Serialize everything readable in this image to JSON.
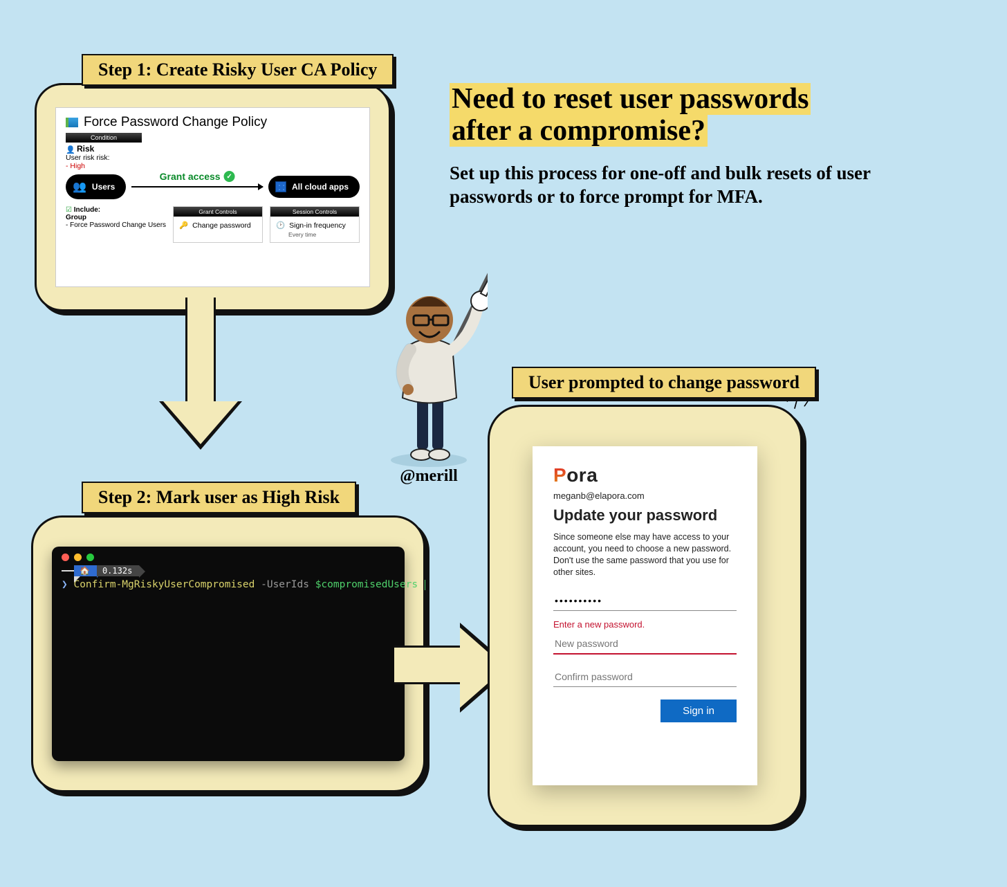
{
  "tags": {
    "step1": "Step 1: Create Risky User CA Policy",
    "step2": "Step 2: Mark user as High Risk",
    "result": "User prompted to change password"
  },
  "headline": {
    "line1": "Need to reset user passwords",
    "line2": "after a compromise?",
    "sub": "Set up this process for one-off and bulk resets of user passwords or to force prompt for MFA."
  },
  "handle": "@merill",
  "policy": {
    "title": "Force Password Change Policy",
    "condition_header": "Condition",
    "risk_label": "Risk",
    "risk_field": "User risk risk:",
    "risk_value": "- High",
    "grant_label": "Grant access",
    "users_pill": "Users",
    "apps_pill": "All cloud apps",
    "include_label": "Include:",
    "include_group": "Group",
    "include_group_value": "- Force Password Change Users",
    "grant_controls_header": "Grant Controls",
    "grant_control_item": "Change password",
    "session_controls_header": "Session Controls",
    "session_control_item": "Sign-in frequency",
    "session_control_sub": "Every time"
  },
  "terminal": {
    "time": "0.132s",
    "prompt": "❯",
    "cmd": "Confirm-MgRiskyUserCompromised",
    "param": "-UserIds",
    "var": "$compromisedUsers"
  },
  "login": {
    "brand": "Pora",
    "email": "meganb@elapora.com",
    "title": "Update your password",
    "desc": "Since someone else may have access to your account, you need to choose a new password. Don't use the same password that you use for other sites.",
    "current_value": "••••••••••",
    "error": "Enter a new password.",
    "new_placeholder": "New password",
    "confirm_placeholder": "Confirm password",
    "button": "Sign in"
  }
}
